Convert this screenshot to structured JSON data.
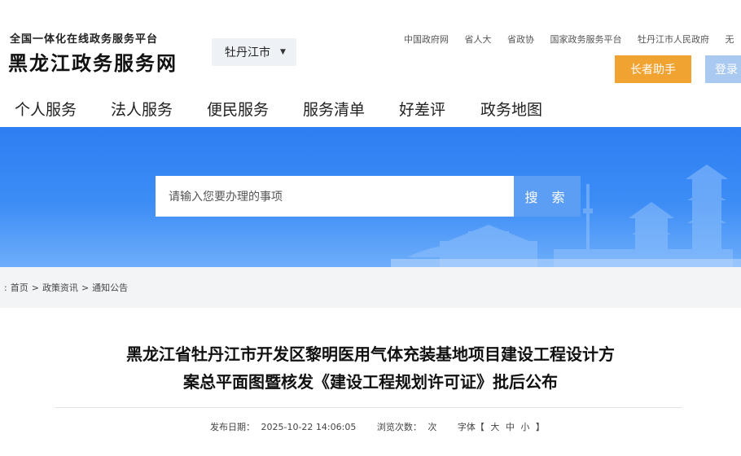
{
  "header": {
    "subtitle": "全国一体化在线政务服务平台",
    "title": "黑龙江政务服务网",
    "city_select": "牡丹江市",
    "top_links": [
      "中国政府网",
      "省人大",
      "省政协",
      "国家政务服务平台",
      "牡丹江市人民政府",
      "无"
    ],
    "elder_button": "长者助手",
    "login_button": "登录"
  },
  "nav": {
    "items": [
      "个人服务",
      "法人服务",
      "便民服务",
      "服务清单",
      "好差评",
      "政务地图"
    ]
  },
  "search": {
    "placeholder": "请输入您要办理的事项",
    "button": "搜 索"
  },
  "breadcrumb": {
    "prefix": ":",
    "items": [
      "首页",
      "政策资讯",
      "通知公告"
    ],
    "separator": ">"
  },
  "article": {
    "title_line1": "黑龙江省牡丹江市开发区黎明医用气体充装基地项目建设工程设计方",
    "title_line2": "案总平面图暨核发《建设工程规划许可证》批后公布",
    "publish_label": "发布日期：",
    "publish_date": "2025-10-22 14:06:05",
    "views_label": "浏览次数：",
    "views_suffix": "次",
    "font_label": "字体【",
    "font_large": "大",
    "font_medium": "中",
    "font_small": "小",
    "font_end": "】"
  },
  "colors": {
    "banner_blue": "#2d7ff2",
    "elder_orange": "#f0a330",
    "login_blue": "#a9c9f1",
    "search_button": "#5d9ef5"
  }
}
